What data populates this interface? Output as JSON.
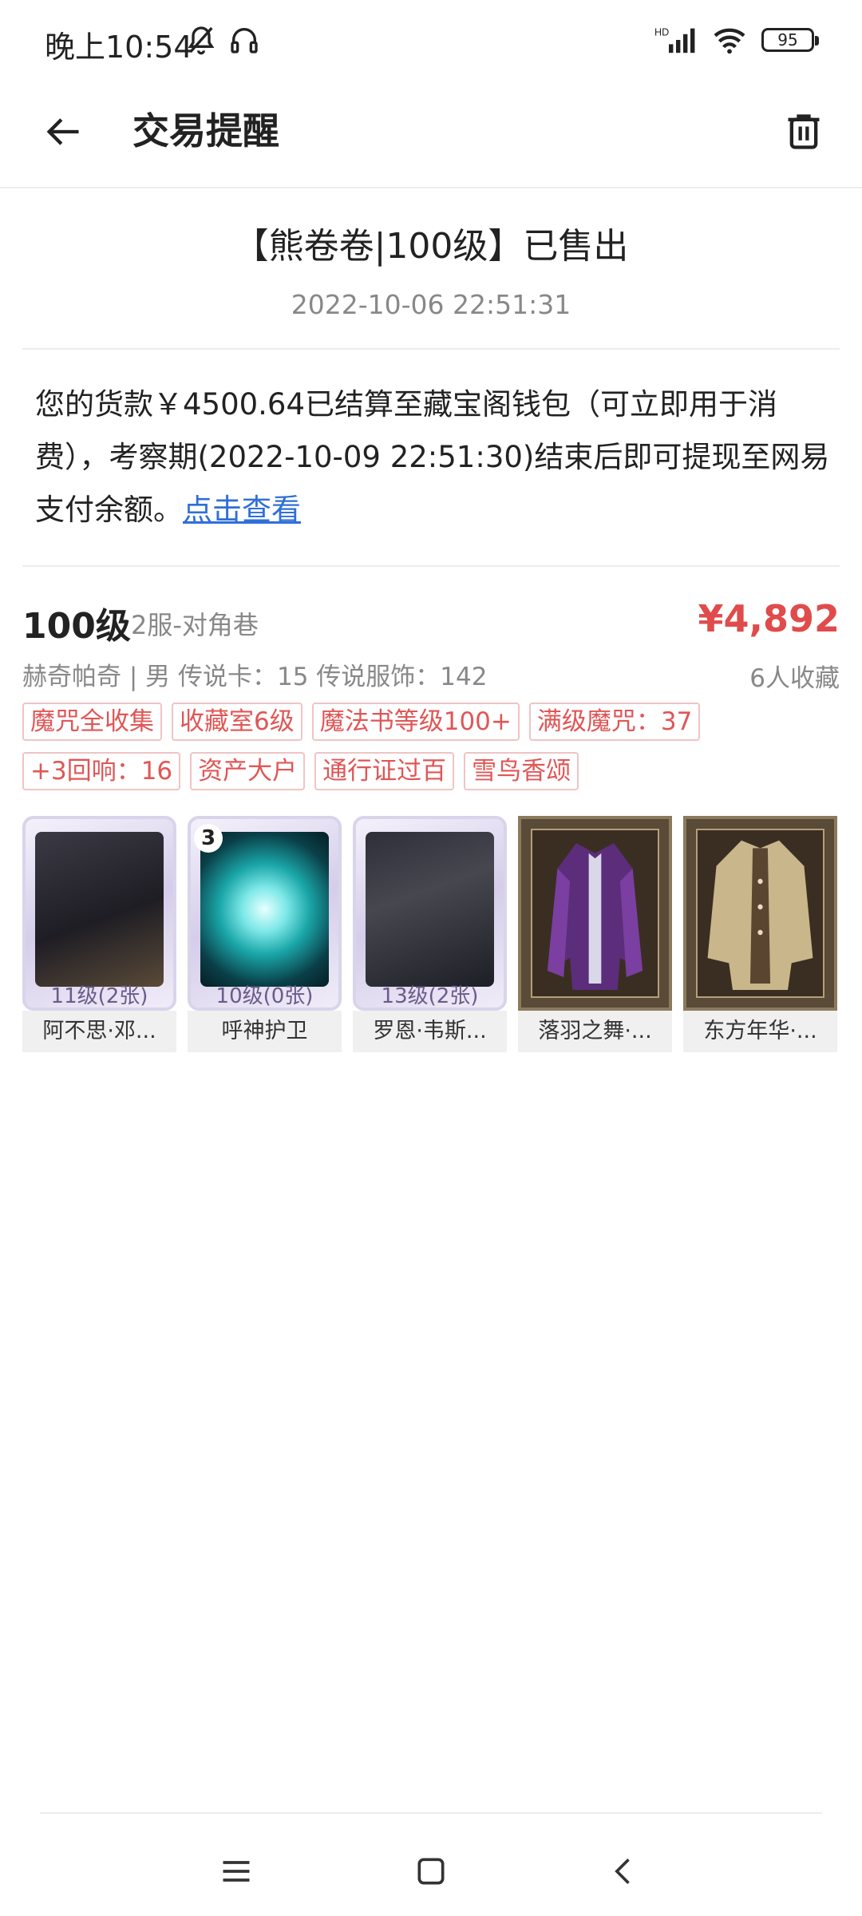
{
  "status": {
    "time": "晚上10:54",
    "battery": "95",
    "icons": [
      "bell-off-icon",
      "headphones-icon",
      "signal-icon",
      "wifi-icon",
      "battery-icon"
    ]
  },
  "header": {
    "title": "交易提醒",
    "back_icon": "arrow-left-icon",
    "trash_icon": "trash-icon"
  },
  "message": {
    "title": "【熊卷卷|100级】已售出",
    "time": "2022-10-06 22:51:31",
    "body": "您的货款￥4500.64已结算至藏宝阁钱包（可立即用于消费），考察期(2022-10-09 22:51:30)结束后即可提现至网易支付余额。",
    "link": "点击查看"
  },
  "listing": {
    "level": "100级",
    "server": "2服-对角巷",
    "price": "¥4,892",
    "role_info": "赫奇帕奇 | 男  传说卡：15  传说服饰：142",
    "favorites": "6人收藏",
    "tags": [
      "魔咒全收集",
      "收藏室6级",
      "魔法书等级100+",
      "满级魔咒：37",
      "+3回响：16",
      "资产大户",
      "通行证过百",
      "雪鸟香颂"
    ],
    "items": [
      {
        "label": "阿不思·邓...",
        "level": "11级(2张)",
        "kind": "card"
      },
      {
        "label": "呼神护卫",
        "level": "10级(0张)",
        "kind": "card",
        "badge": "3"
      },
      {
        "label": "罗恩·韦斯...",
        "level": "13级(2张)",
        "kind": "card"
      },
      {
        "label": "落羽之舞·...",
        "kind": "outfit"
      },
      {
        "label": "东方年华·...",
        "kind": "outfit"
      }
    ]
  },
  "nav": {
    "icons": [
      "menu-icon",
      "home-icon",
      "back-icon"
    ]
  }
}
